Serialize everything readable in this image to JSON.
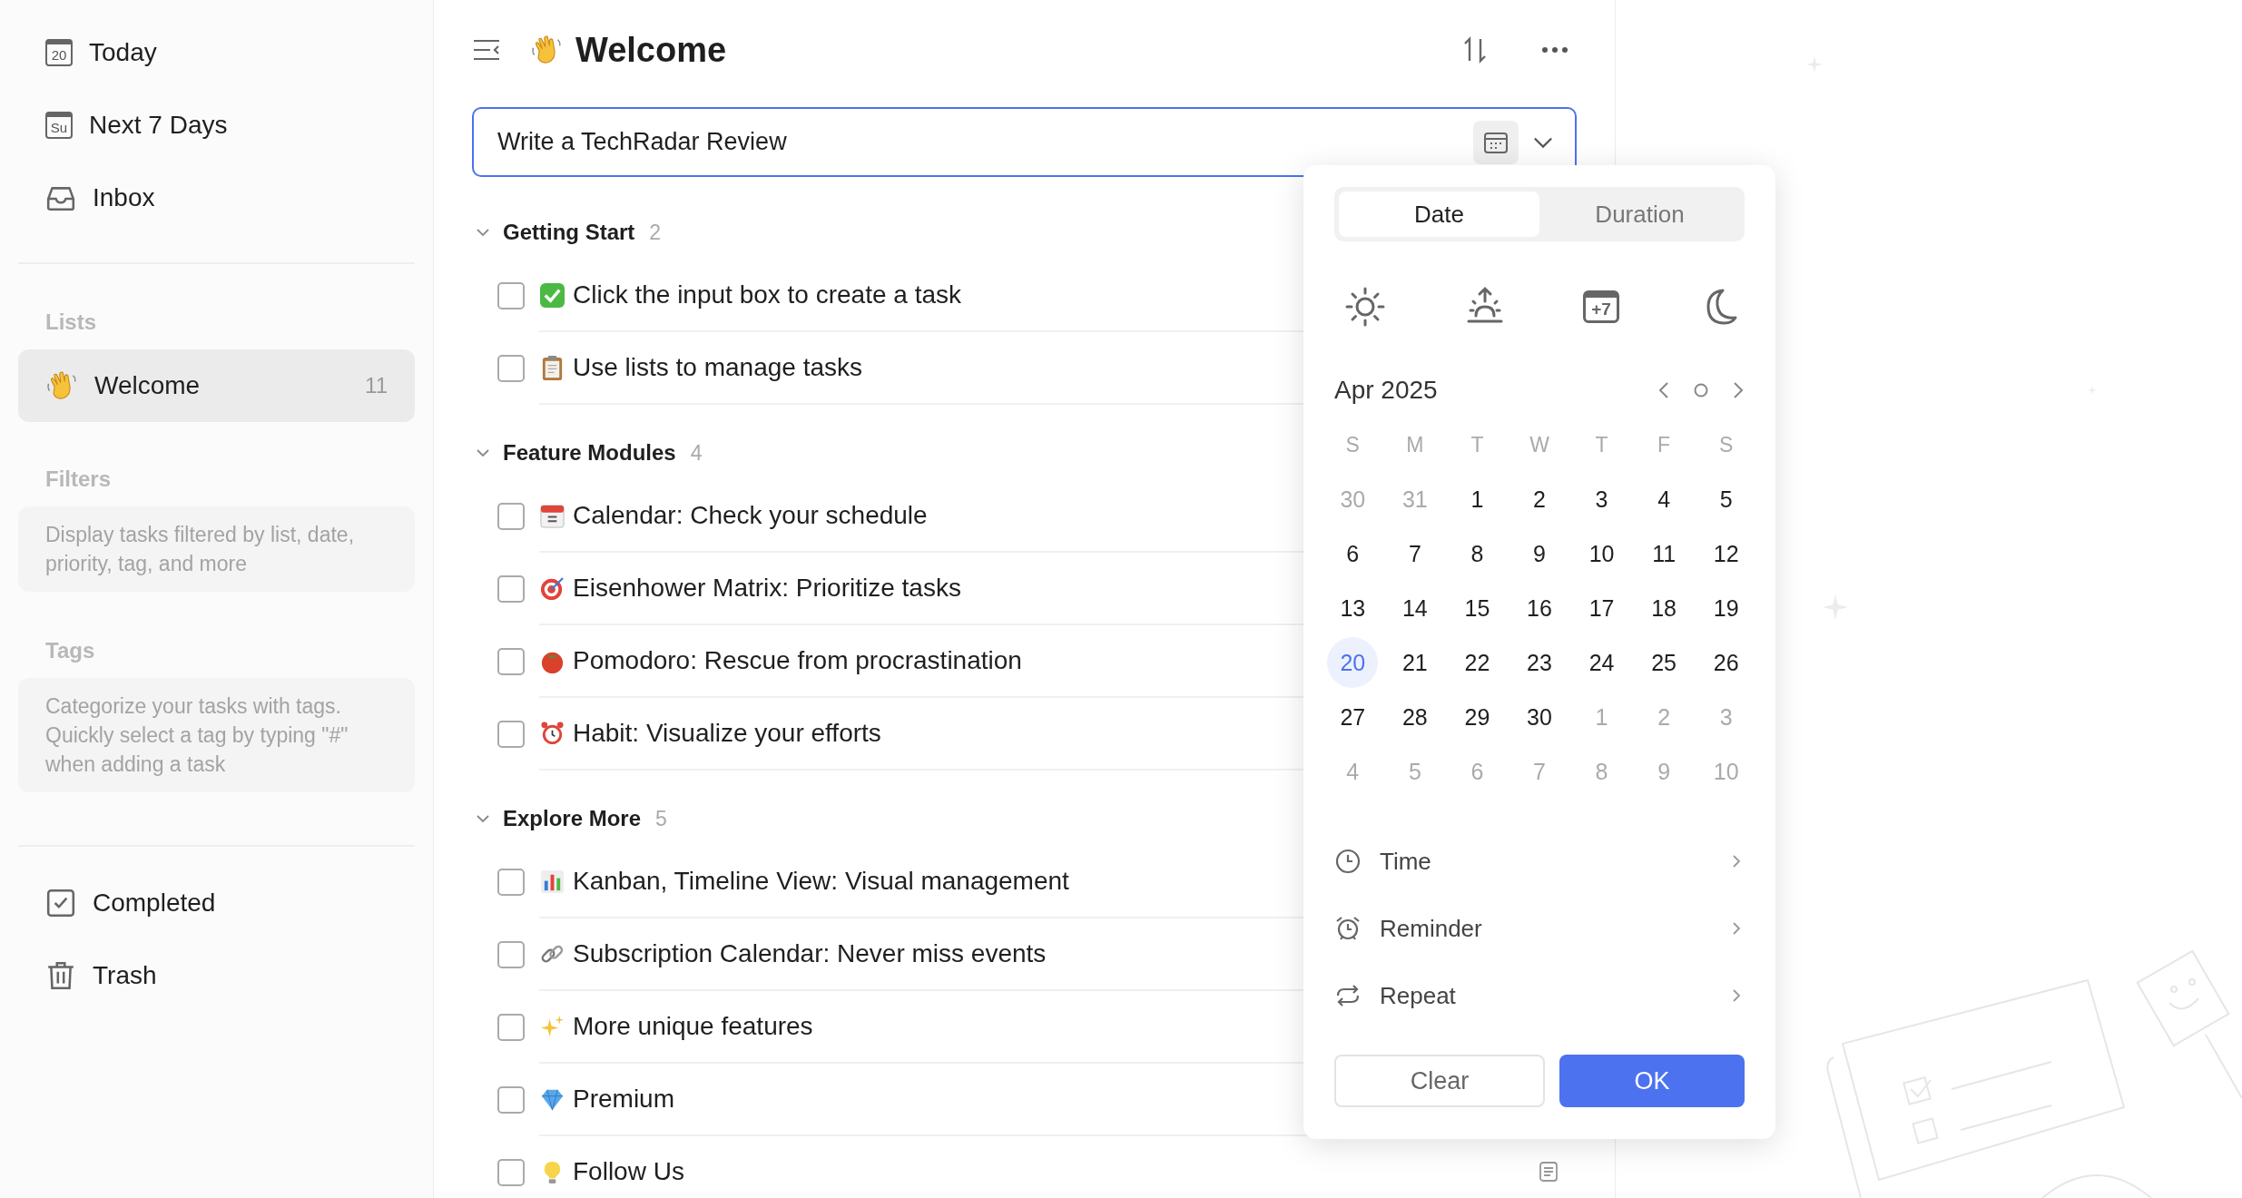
{
  "sidebar": {
    "smart_lists": [
      {
        "kind": "today",
        "icon_text": "20",
        "label": "Today"
      },
      {
        "kind": "week",
        "icon_text": "Su",
        "label": "Next 7 Days"
      },
      {
        "kind": "inbox",
        "label": "Inbox"
      }
    ],
    "lists_heading": "Lists",
    "lists": [
      {
        "label": "Welcome",
        "count": "11",
        "selected": true
      }
    ],
    "filters_heading": "Filters",
    "filters_hint": "Display tasks filtered by list, date, priority, tag, and more",
    "tags_heading": "Tags",
    "tags_hint": "Categorize your tasks with tags. Quickly select a tag by typing \"#\" when adding a task",
    "bottom_items": [
      {
        "kind": "completed",
        "label": "Completed"
      },
      {
        "kind": "trash",
        "label": "Trash"
      }
    ]
  },
  "main": {
    "title": "Welcome",
    "task_input": {
      "value": "Write a TechRadar Review"
    },
    "sections": [
      {
        "title": "Getting Start",
        "count": "2",
        "expanded": true,
        "tasks": [
          {
            "kind": "check",
            "title": "Click the input box to create a task",
            "checked": false,
            "has_note": false
          },
          {
            "kind": "clipboard",
            "title": "Use lists to manage tasks",
            "checked": false,
            "has_note": false
          }
        ]
      },
      {
        "title": "Feature Modules",
        "count": "4",
        "expanded": true,
        "tasks": [
          {
            "kind": "calendar",
            "title": "Calendar: Check your schedule",
            "checked": false,
            "has_note": false
          },
          {
            "kind": "target",
            "title": "Eisenhower Matrix: Prioritize tasks",
            "checked": false,
            "has_note": false
          },
          {
            "kind": "tomato",
            "title": "Pomodoro: Rescue from procrastination",
            "checked": false,
            "has_note": false
          },
          {
            "kind": "alarm",
            "title": "Habit: Visualize your efforts",
            "checked": false,
            "has_note": false
          }
        ]
      },
      {
        "title": "Explore More",
        "count": "5",
        "expanded": true,
        "tasks": [
          {
            "kind": "chart",
            "title": "Kanban, Timeline View: Visual management",
            "checked": false,
            "has_note": false
          },
          {
            "kind": "link",
            "title": "Subscription Calendar: Never miss events",
            "checked": false,
            "has_note": false
          },
          {
            "kind": "sparkles",
            "title": "More unique features",
            "checked": false,
            "has_note": false
          },
          {
            "kind": "gem",
            "title": "Premium",
            "checked": false,
            "has_note": false
          },
          {
            "kind": "bulb",
            "title": "Follow Us",
            "checked": false,
            "has_note": true
          }
        ]
      }
    ]
  },
  "date_picker": {
    "tabs": [
      {
        "label": "Date",
        "selected": true
      },
      {
        "label": "Duration",
        "selected": false
      }
    ],
    "quick_options": [
      {
        "kind": "sun"
      },
      {
        "kind": "sunrise"
      },
      {
        "kind": "next-week",
        "label": "+7"
      },
      {
        "kind": "moon"
      }
    ],
    "month": "Apr 2025",
    "weekdays": [
      "S",
      "M",
      "T",
      "W",
      "T",
      "F",
      "S"
    ],
    "weeks": [
      [
        {
          "day": "30",
          "other_month": true,
          "selected": false
        },
        {
          "day": "31",
          "other_month": true,
          "selected": false
        },
        {
          "day": "1",
          "other_month": false,
          "selected": false
        },
        {
          "day": "2",
          "other_month": false,
          "selected": false
        },
        {
          "day": "3",
          "other_month": false,
          "selected": false
        },
        {
          "day": "4",
          "other_month": false,
          "selected": false
        },
        {
          "day": "5",
          "other_month": false,
          "selected": false
        }
      ],
      [
        {
          "day": "6",
          "other_month": false,
          "selected": false
        },
        {
          "day": "7",
          "other_month": false,
          "selected": false
        },
        {
          "day": "8",
          "other_month": false,
          "selected": false
        },
        {
          "day": "9",
          "other_month": false,
          "selected": false
        },
        {
          "day": "10",
          "other_month": false,
          "selected": false
        },
        {
          "day": "11",
          "other_month": false,
          "selected": false
        },
        {
          "day": "12",
          "other_month": false,
          "selected": false
        }
      ],
      [
        {
          "day": "13",
          "other_month": false,
          "selected": false
        },
        {
          "day": "14",
          "other_month": false,
          "selected": false
        },
        {
          "day": "15",
          "other_month": false,
          "selected": false
        },
        {
          "day": "16",
          "other_month": false,
          "selected": false
        },
        {
          "day": "17",
          "other_month": false,
          "selected": false
        },
        {
          "day": "18",
          "other_month": false,
          "selected": false
        },
        {
          "day": "19",
          "other_month": false,
          "selected": false
        }
      ],
      [
        {
          "day": "20",
          "other_month": false,
          "selected": true
        },
        {
          "day": "21",
          "other_month": false,
          "selected": false
        },
        {
          "day": "22",
          "other_month": false,
          "selected": false
        },
        {
          "day": "23",
          "other_month": false,
          "selected": false
        },
        {
          "day": "24",
          "other_month": false,
          "selected": false
        },
        {
          "day": "25",
          "other_month": false,
          "selected": false
        },
        {
          "day": "26",
          "other_month": false,
          "selected": false
        }
      ],
      [
        {
          "day": "27",
          "other_month": false,
          "selected": false
        },
        {
          "day": "28",
          "other_month": false,
          "selected": false
        },
        {
          "day": "29",
          "other_month": false,
          "selected": false
        },
        {
          "day": "30",
          "other_month": false,
          "selected": false
        },
        {
          "day": "1",
          "other_month": true,
          "selected": false
        },
        {
          "day": "2",
          "other_month": true,
          "selected": false
        },
        {
          "day": "3",
          "other_month": true,
          "selected": false
        }
      ],
      [
        {
          "day": "4",
          "other_month": true,
          "selected": false
        },
        {
          "day": "5",
          "other_month": true,
          "selected": false
        },
        {
          "day": "6",
          "other_month": true,
          "selected": false
        },
        {
          "day": "7",
          "other_month": true,
          "selected": false
        },
        {
          "day": "8",
          "other_month": true,
          "selected": false
        },
        {
          "day": "9",
          "other_month": true,
          "selected": false
        },
        {
          "day": "10",
          "other_month": true,
          "selected": false
        }
      ]
    ],
    "options": [
      {
        "kind": "time",
        "label": "Time"
      },
      {
        "kind": "reminder",
        "label": "Reminder"
      },
      {
        "kind": "repeat",
        "label": "Repeat"
      }
    ],
    "clear_button": "Clear",
    "ok_button": "OK"
  }
}
